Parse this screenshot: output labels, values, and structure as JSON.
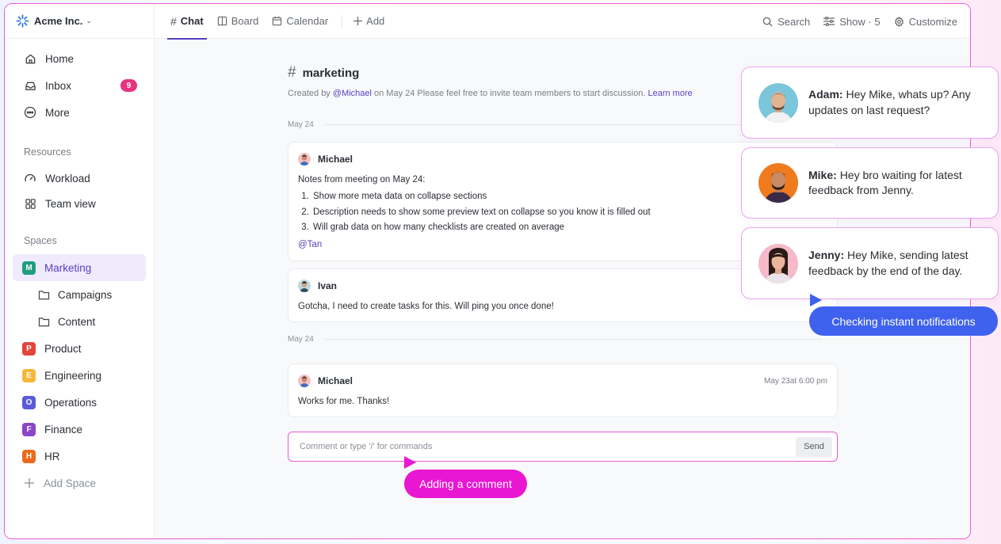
{
  "workspace": {
    "name": "Acme Inc."
  },
  "nav": [
    {
      "id": "home",
      "label": "Home",
      "icon": "home-icon"
    },
    {
      "id": "inbox",
      "label": "Inbox",
      "icon": "inbox-icon",
      "badge": "9"
    },
    {
      "id": "more",
      "label": "More",
      "icon": "more-icon"
    }
  ],
  "resources": {
    "title": "Resources",
    "items": [
      {
        "label": "Workload",
        "icon": "gauge-icon"
      },
      {
        "label": "Team view",
        "icon": "grid-icon"
      }
    ]
  },
  "spaces": {
    "title": "Spaces",
    "items": [
      {
        "letter": "M",
        "label": "Marketing",
        "color": "#1f9d7e",
        "active": true
      },
      {
        "label": "Campaigns",
        "folder": true
      },
      {
        "label": "Content",
        "folder": true
      },
      {
        "letter": "P",
        "label": "Product",
        "color": "#e2453c"
      },
      {
        "letter": "E",
        "label": "Engineering",
        "color": "#f5b73b"
      },
      {
        "letter": "O",
        "label": "Operations",
        "color": "#5a5bd8"
      },
      {
        "letter": "F",
        "label": "Finance",
        "color": "#8b46c7"
      },
      {
        "letter": "H",
        "label": "HR",
        "color": "#ec6a1c"
      }
    ],
    "add_label": "Add Space"
  },
  "tabs": [
    {
      "label": "Chat",
      "active": true
    },
    {
      "label": "Board"
    },
    {
      "label": "Calendar"
    },
    {
      "label": "Add"
    }
  ],
  "toolbar": {
    "search": "Search",
    "show": "Show · 5",
    "customize": "Customize"
  },
  "channel": {
    "name": "marketing",
    "created_prefix": "Created by",
    "created_by": "@Michael",
    "created_suffix": "on May 24  Please feel free to invite team members to start discussion.",
    "learn_more": "Learn more"
  },
  "date_dividers": [
    "May 24",
    "May 24"
  ],
  "messages": [
    {
      "author": "Michael",
      "intro": "Notes from meeting on May 24:",
      "list": [
        "Show more meta data on collapse sections",
        "Description needs to show some preview text on collapse so you know it is filled out",
        "Will grab data on how many checklists are created on average"
      ],
      "mention": "@Tan"
    },
    {
      "author": "Ivan",
      "text": "Gotcha, I need to create tasks for this. Will ping you once done!"
    },
    {
      "author": "Michael",
      "time": "May 23at 6:00 pm",
      "text": "Works for me. Thanks!"
    }
  ],
  "comment": {
    "placeholder": "Comment or type '/' for commands",
    "send": "Send"
  },
  "notifications": [
    {
      "name": "Adam:",
      "text": "Hey Mike, whats up? Any updates on last request?"
    },
    {
      "name": "Mike:",
      "text": "Hey bro waiting for latest feedback from Jenny."
    },
    {
      "name": "Jenny:",
      "text": "Hey Mike, sending latest feedback by the end of the day."
    }
  ],
  "callouts": {
    "comment": "Adding a comment",
    "notifications": "Checking instant notifications"
  },
  "colors": {
    "accent": "#5a3fc0",
    "highlight": "#e85ad6",
    "callout_pink": "#ea17d2",
    "callout_blue": "#3f62ee",
    "badge": "#e8347e"
  }
}
